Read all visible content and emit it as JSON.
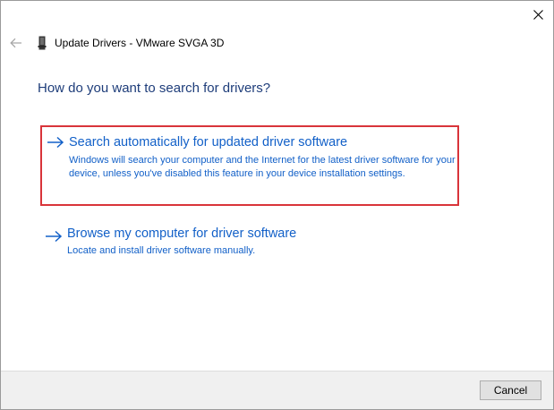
{
  "window": {
    "title": "Update Drivers - VMware SVGA 3D"
  },
  "heading": "How do you want to search for drivers?",
  "options": [
    {
      "title": "Search automatically for updated driver software",
      "description": "Windows will search your computer and the Internet for the latest driver software for your device, unless you've disabled this feature in your device installation settings.",
      "icon": "arrow-right-icon",
      "highlighted": true,
      "highlight_color": "#d9343a"
    },
    {
      "title": "Browse my computer for driver software",
      "description": "Locate and install driver software manually.",
      "icon": "arrow-right-icon",
      "highlighted": false
    }
  ],
  "footer": {
    "cancel_label": "Cancel"
  },
  "icons": {
    "close": "close-icon",
    "back": "back-arrow-icon",
    "device": "device-icon"
  },
  "colors": {
    "link": "#1260c8",
    "heading": "#1e3d7a",
    "highlight": "#d9343a",
    "footer_bg": "#f0f0f0"
  }
}
